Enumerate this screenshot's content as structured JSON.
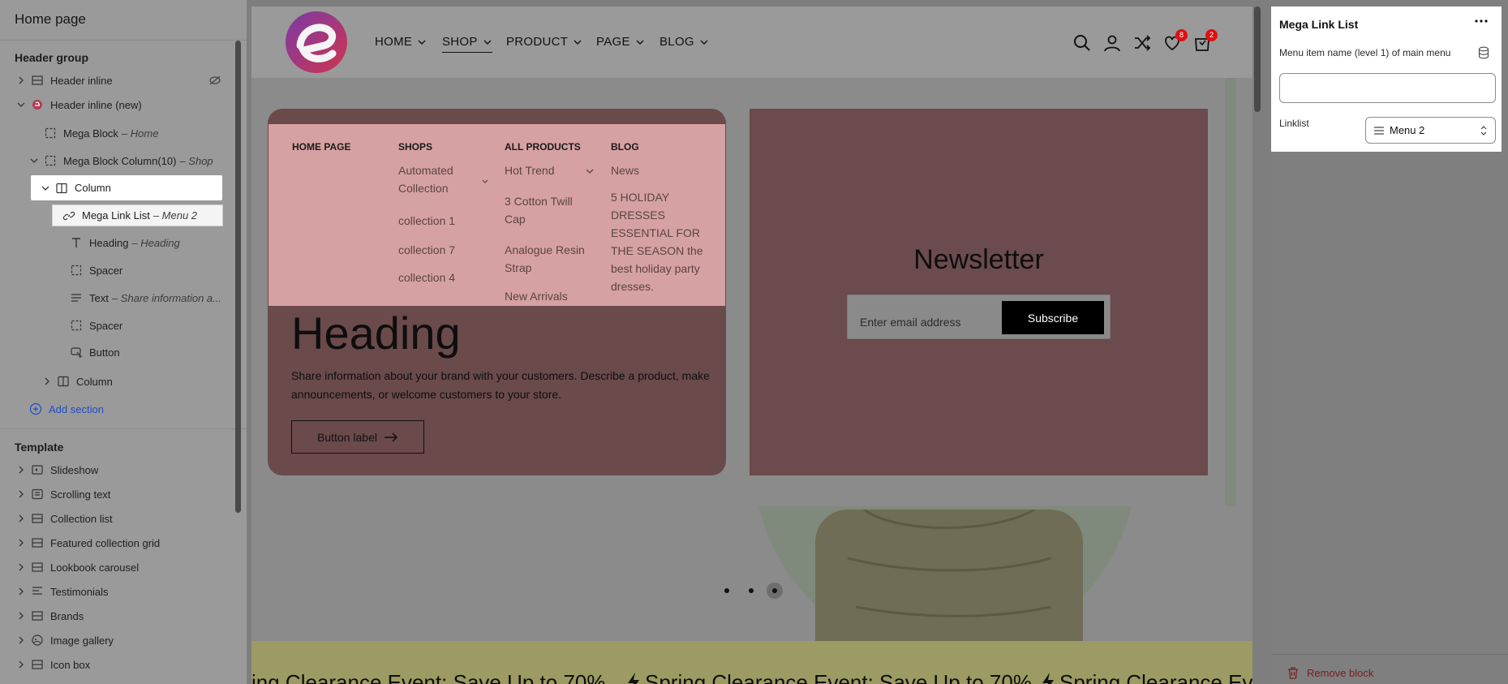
{
  "sidebar": {
    "title": "Home page",
    "header_group": {
      "label": "Header group",
      "items": [
        {
          "label": "Header inline",
          "sub": ""
        },
        {
          "label": "Header inline (new)",
          "sub": ""
        },
        {
          "label": "Mega Block",
          "sub": "– Home"
        },
        {
          "label": "Mega Block Column(10)",
          "sub": "– Shop"
        },
        {
          "label": "Column",
          "sub": ""
        },
        {
          "label": "Mega Link List",
          "sub": "– Menu 2"
        },
        {
          "label": "Heading",
          "sub": "– Heading"
        },
        {
          "label": "Spacer",
          "sub": ""
        },
        {
          "label": "Text",
          "sub": "– Share information a..."
        },
        {
          "label": "Spacer",
          "sub": ""
        },
        {
          "label": "Button",
          "sub": ""
        },
        {
          "label": "Column",
          "sub": ""
        }
      ],
      "add_section": "Add section"
    },
    "template": {
      "label": "Template",
      "items": [
        "Slideshow",
        "Scrolling text",
        "Collection list",
        "Featured collection grid",
        "Lookbook carousel",
        "Testimonials",
        "Brands",
        "Image gallery",
        "Icon box"
      ]
    }
  },
  "preview": {
    "nav": [
      "HOME",
      "SHOP",
      "PRODUCT",
      "PAGE",
      "BLOG"
    ],
    "wishlist_count": "8",
    "cart_count": "2",
    "mega_menu": {
      "columns": [
        {
          "heading": "HOME PAGE",
          "links": []
        },
        {
          "heading": "SHOPS",
          "links": [
            "Automated Collection",
            "collection 1",
            "collection 7",
            "collection 4"
          ]
        },
        {
          "heading": "ALL PRODUCTS",
          "links": [
            "Hot Trend",
            "3 Cotton Twill Cap",
            "Analogue Resin Strap",
            "New Arrivals"
          ]
        },
        {
          "heading": "BLOG",
          "links": [
            "News",
            "5 HOLIDAY DRESSES ESSENTIAL FOR THE SEASON the best holiday party dresses."
          ]
        }
      ]
    },
    "heading": "Heading",
    "paragraph": "Share information about your brand with your customers. Describe a product, make announcements, or welcome customers to your store.",
    "button_label": "Button label",
    "newsletter": {
      "title": "Newsletter",
      "placeholder": "Enter email address",
      "button": "Subscribe"
    },
    "slider_dots": 3,
    "slider_active": 3,
    "marquee": [
      "ing Clearance Event: Save Up to 70%",
      "Spring Clearance Event: Save Up to 70%",
      "Spring Clearance Eve"
    ]
  },
  "panel": {
    "title": "Mega Link List",
    "field1_label": "Menu item name (level 1) of main menu",
    "field1_value": "",
    "linklist_label": "Linklist",
    "linklist_value": "Menu 2",
    "remove_label": "Remove block"
  },
  "colors": {
    "accent": "#1d4ec7",
    "badge": "#dd1111",
    "mega_bg": "#d6a1a2",
    "card_bg": "#6b4a4c",
    "marquee_bg": "#9b9b63"
  }
}
